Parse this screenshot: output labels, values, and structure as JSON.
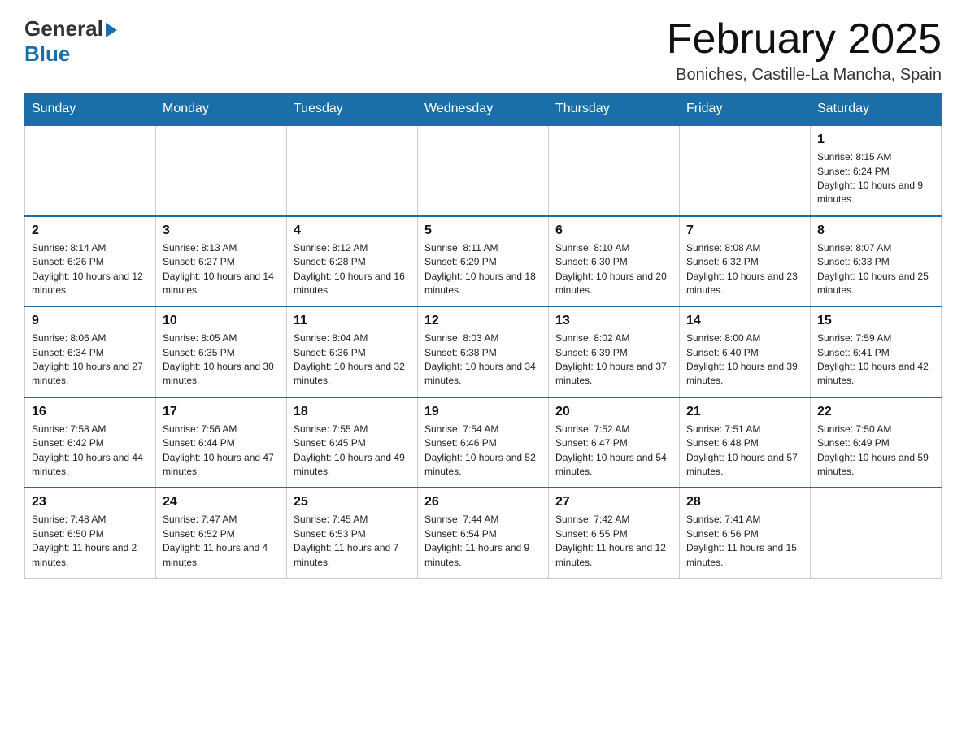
{
  "logo": {
    "general": "General",
    "blue": "Blue"
  },
  "title": "February 2025",
  "location": "Boniches, Castille-La Mancha, Spain",
  "weekdays": [
    "Sunday",
    "Monday",
    "Tuesday",
    "Wednesday",
    "Thursday",
    "Friday",
    "Saturday"
  ],
  "weeks": [
    [
      {
        "day": "",
        "info": ""
      },
      {
        "day": "",
        "info": ""
      },
      {
        "day": "",
        "info": ""
      },
      {
        "day": "",
        "info": ""
      },
      {
        "day": "",
        "info": ""
      },
      {
        "day": "",
        "info": ""
      },
      {
        "day": "1",
        "info": "Sunrise: 8:15 AM\nSunset: 6:24 PM\nDaylight: 10 hours and 9 minutes."
      }
    ],
    [
      {
        "day": "2",
        "info": "Sunrise: 8:14 AM\nSunset: 6:26 PM\nDaylight: 10 hours and 12 minutes."
      },
      {
        "day": "3",
        "info": "Sunrise: 8:13 AM\nSunset: 6:27 PM\nDaylight: 10 hours and 14 minutes."
      },
      {
        "day": "4",
        "info": "Sunrise: 8:12 AM\nSunset: 6:28 PM\nDaylight: 10 hours and 16 minutes."
      },
      {
        "day": "5",
        "info": "Sunrise: 8:11 AM\nSunset: 6:29 PM\nDaylight: 10 hours and 18 minutes."
      },
      {
        "day": "6",
        "info": "Sunrise: 8:10 AM\nSunset: 6:30 PM\nDaylight: 10 hours and 20 minutes."
      },
      {
        "day": "7",
        "info": "Sunrise: 8:08 AM\nSunset: 6:32 PM\nDaylight: 10 hours and 23 minutes."
      },
      {
        "day": "8",
        "info": "Sunrise: 8:07 AM\nSunset: 6:33 PM\nDaylight: 10 hours and 25 minutes."
      }
    ],
    [
      {
        "day": "9",
        "info": "Sunrise: 8:06 AM\nSunset: 6:34 PM\nDaylight: 10 hours and 27 minutes."
      },
      {
        "day": "10",
        "info": "Sunrise: 8:05 AM\nSunset: 6:35 PM\nDaylight: 10 hours and 30 minutes."
      },
      {
        "day": "11",
        "info": "Sunrise: 8:04 AM\nSunset: 6:36 PM\nDaylight: 10 hours and 32 minutes."
      },
      {
        "day": "12",
        "info": "Sunrise: 8:03 AM\nSunset: 6:38 PM\nDaylight: 10 hours and 34 minutes."
      },
      {
        "day": "13",
        "info": "Sunrise: 8:02 AM\nSunset: 6:39 PM\nDaylight: 10 hours and 37 minutes."
      },
      {
        "day": "14",
        "info": "Sunrise: 8:00 AM\nSunset: 6:40 PM\nDaylight: 10 hours and 39 minutes."
      },
      {
        "day": "15",
        "info": "Sunrise: 7:59 AM\nSunset: 6:41 PM\nDaylight: 10 hours and 42 minutes."
      }
    ],
    [
      {
        "day": "16",
        "info": "Sunrise: 7:58 AM\nSunset: 6:42 PM\nDaylight: 10 hours and 44 minutes."
      },
      {
        "day": "17",
        "info": "Sunrise: 7:56 AM\nSunset: 6:44 PM\nDaylight: 10 hours and 47 minutes."
      },
      {
        "day": "18",
        "info": "Sunrise: 7:55 AM\nSunset: 6:45 PM\nDaylight: 10 hours and 49 minutes."
      },
      {
        "day": "19",
        "info": "Sunrise: 7:54 AM\nSunset: 6:46 PM\nDaylight: 10 hours and 52 minutes."
      },
      {
        "day": "20",
        "info": "Sunrise: 7:52 AM\nSunset: 6:47 PM\nDaylight: 10 hours and 54 minutes."
      },
      {
        "day": "21",
        "info": "Sunrise: 7:51 AM\nSunset: 6:48 PM\nDaylight: 10 hours and 57 minutes."
      },
      {
        "day": "22",
        "info": "Sunrise: 7:50 AM\nSunset: 6:49 PM\nDaylight: 10 hours and 59 minutes."
      }
    ],
    [
      {
        "day": "23",
        "info": "Sunrise: 7:48 AM\nSunset: 6:50 PM\nDaylight: 11 hours and 2 minutes."
      },
      {
        "day": "24",
        "info": "Sunrise: 7:47 AM\nSunset: 6:52 PM\nDaylight: 11 hours and 4 minutes."
      },
      {
        "day": "25",
        "info": "Sunrise: 7:45 AM\nSunset: 6:53 PM\nDaylight: 11 hours and 7 minutes."
      },
      {
        "day": "26",
        "info": "Sunrise: 7:44 AM\nSunset: 6:54 PM\nDaylight: 11 hours and 9 minutes."
      },
      {
        "day": "27",
        "info": "Sunrise: 7:42 AM\nSunset: 6:55 PM\nDaylight: 11 hours and 12 minutes."
      },
      {
        "day": "28",
        "info": "Sunrise: 7:41 AM\nSunset: 6:56 PM\nDaylight: 11 hours and 15 minutes."
      },
      {
        "day": "",
        "info": ""
      }
    ]
  ]
}
